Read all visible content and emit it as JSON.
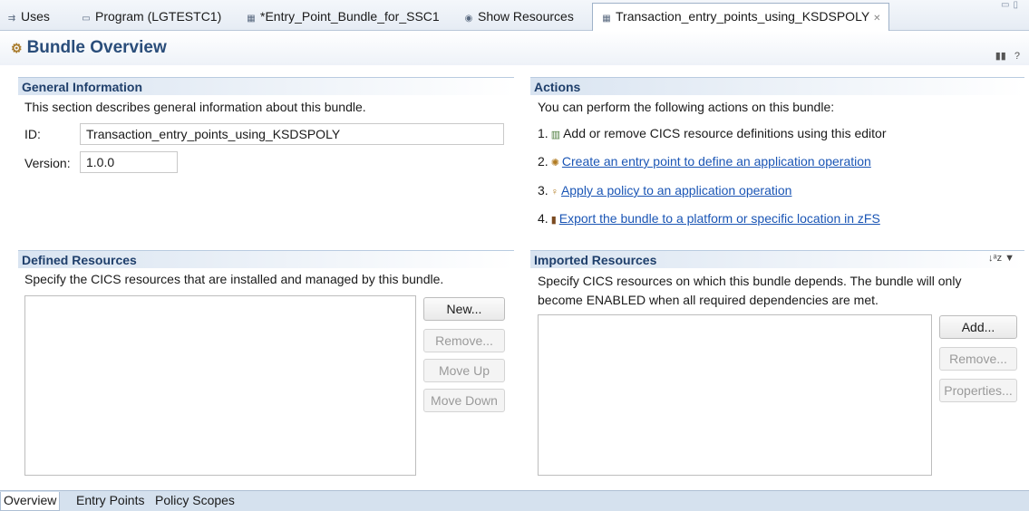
{
  "tabs": [
    {
      "label": "Uses",
      "icon": "uses-icon",
      "glyph": "⇉"
    },
    {
      "label": "Program (LGTESTC1)",
      "icon": "program-icon",
      "glyph": "▭"
    },
    {
      "label": "*Entry_Point_Bundle_for_SSC1",
      "icon": "bundle-file-icon",
      "glyph": "▦"
    },
    {
      "label": "Show Resources",
      "icon": "resources-icon",
      "glyph": "◉"
    },
    {
      "label": "Transaction_entry_points_using_KSDSPOLY",
      "icon": "bundle-file-icon",
      "glyph": "▦",
      "active": true
    }
  ],
  "header": {
    "title": "Bundle Overview"
  },
  "general": {
    "heading": "General Information",
    "description": "This section describes general information about this bundle.",
    "id_label": "ID:",
    "id_value": "Transaction_entry_points_using_KSDSPOLY",
    "version_label": "Version:",
    "version_value": "1.0.0"
  },
  "actions": {
    "heading": "Actions",
    "intro": "You can perform the following actions on this bundle:",
    "items": [
      {
        "num": "1.",
        "text": "Add or remove CICS resource definitions using this editor",
        "link": false
      },
      {
        "num": "2.",
        "text": "Create an entry point to define an application operation",
        "link": true
      },
      {
        "num": "3.",
        "text": "Apply a policy to an application operation",
        "link": true
      },
      {
        "num": "4.",
        "text": "Export the bundle to a platform or specific location in zFS",
        "link": true
      }
    ]
  },
  "defined": {
    "heading": "Defined Resources",
    "description": "Specify the CICS resources that are installed and managed by this bundle.",
    "buttons": {
      "new": "New...",
      "remove": "Remove...",
      "move_up": "Move Up",
      "move_down": "Move Down"
    }
  },
  "imported": {
    "heading": "Imported Resources",
    "description_line1": "Specify CICS resources on which this bundle depends. The bundle will only",
    "description_line2": "become ENABLED when all required dependencies are met.",
    "buttons": {
      "add": "Add...",
      "remove": "Remove...",
      "properties": "Properties..."
    }
  },
  "bottom_tabs": [
    "Overview",
    "Entry Points",
    "Policy Scopes"
  ]
}
